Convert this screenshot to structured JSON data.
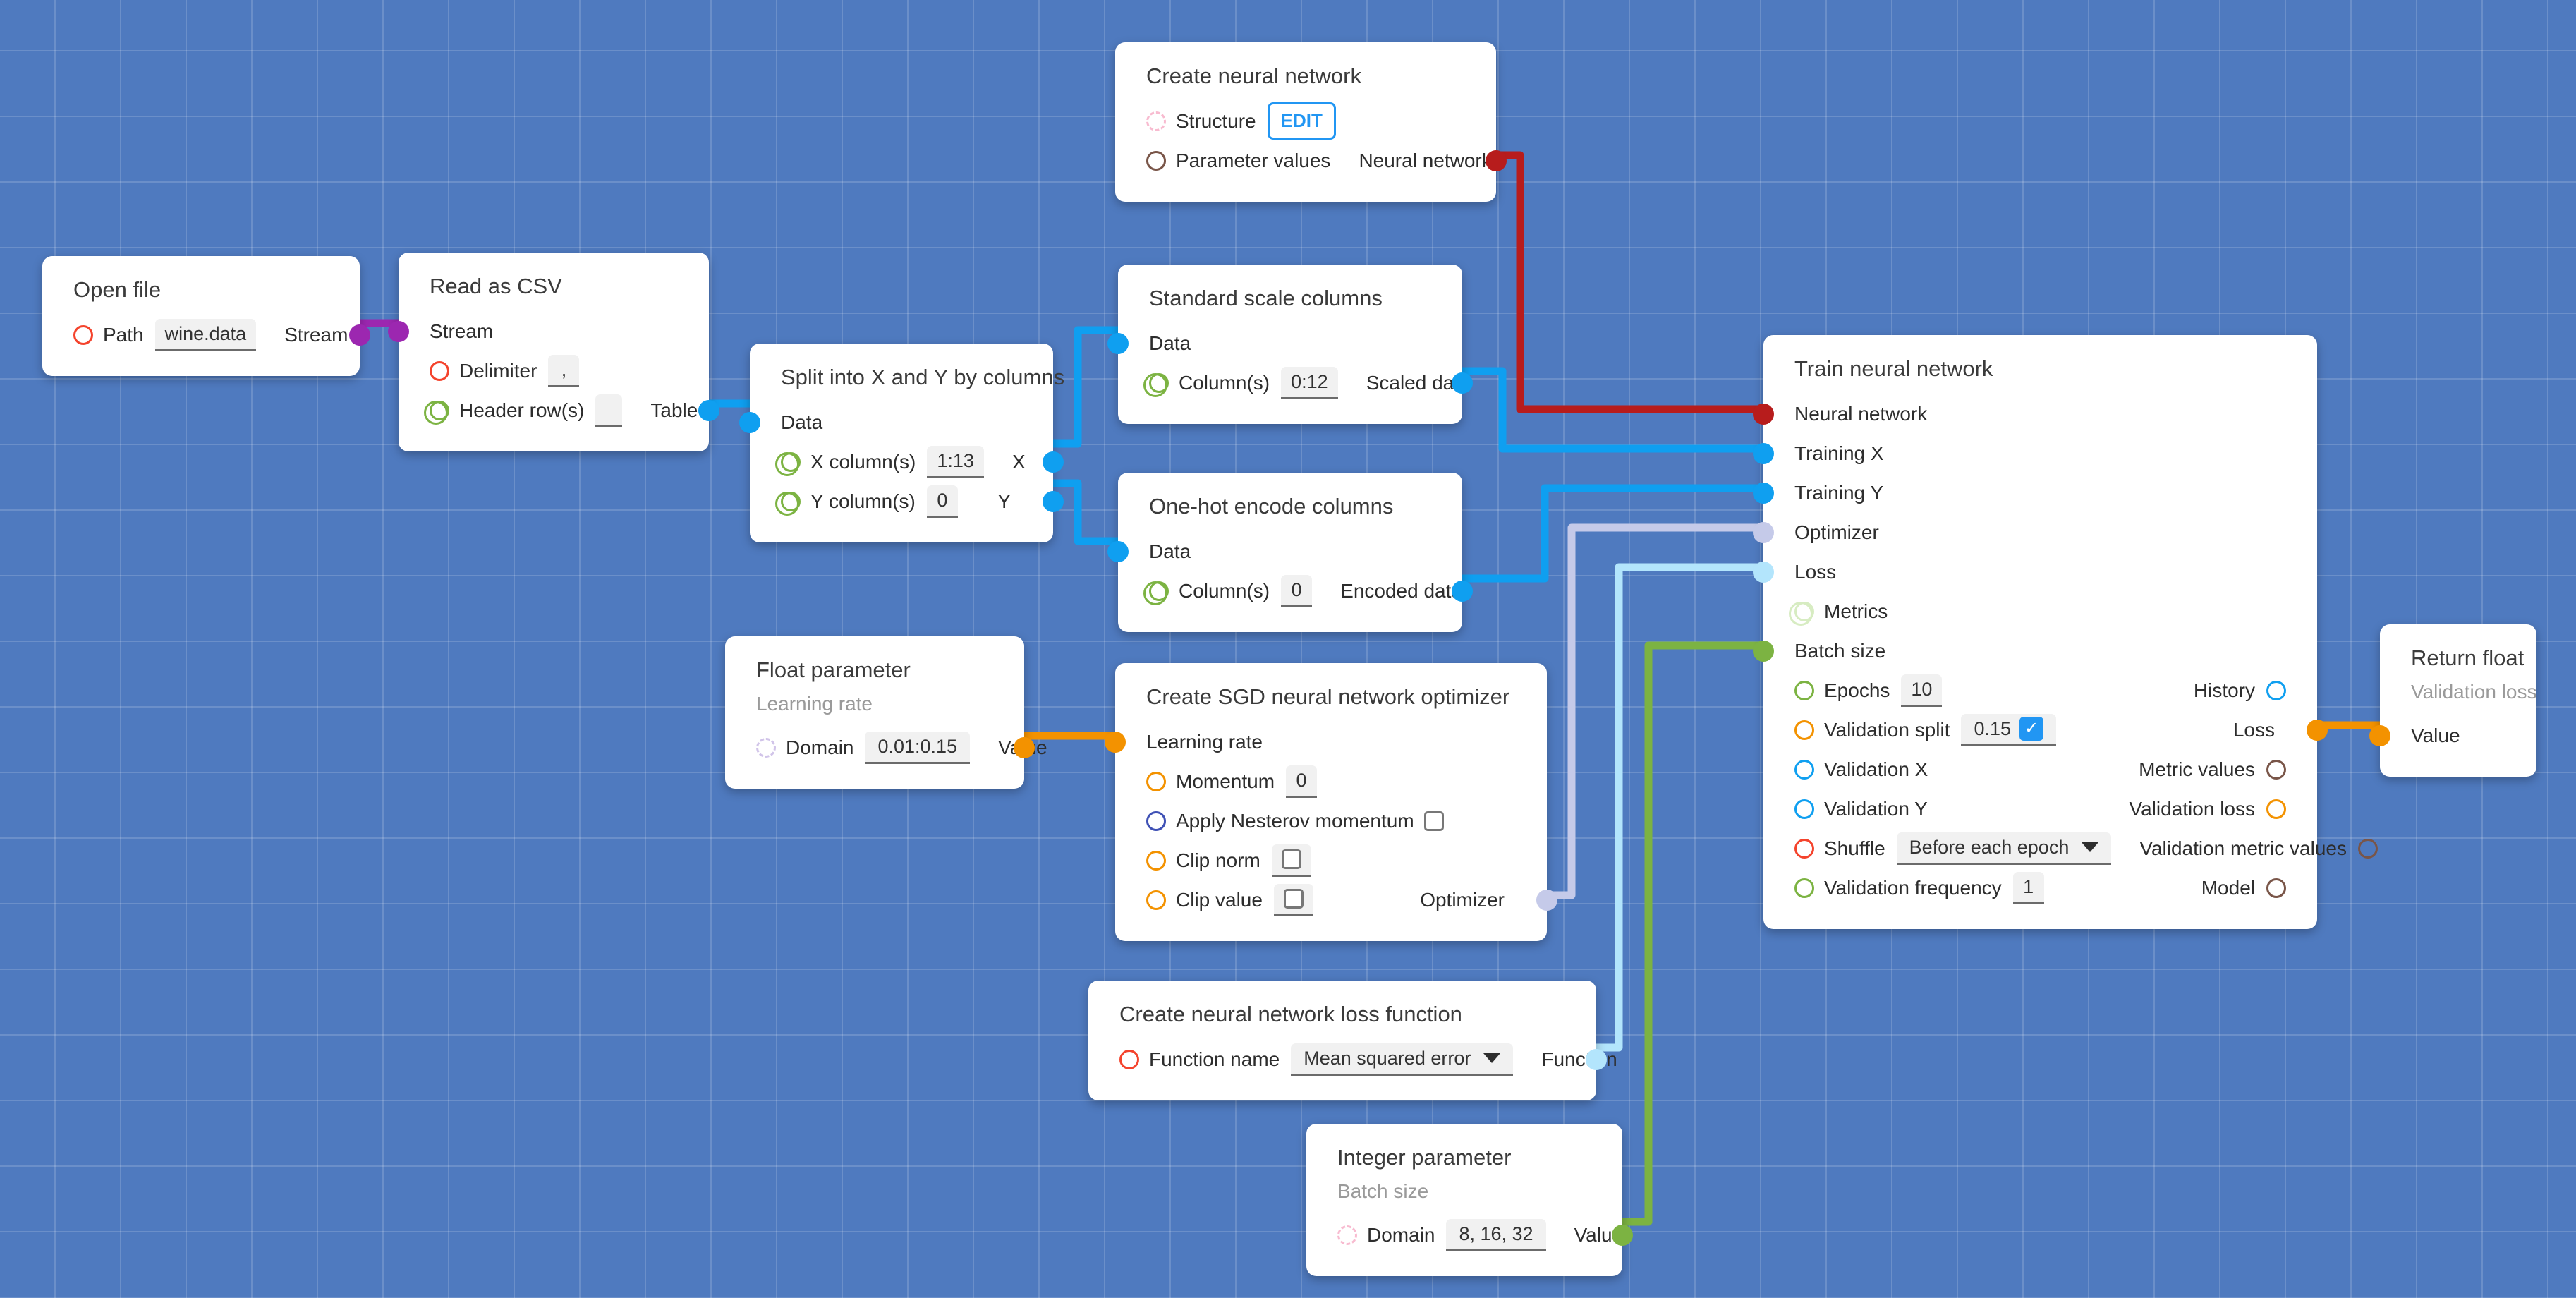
{
  "canvas": {
    "background_color": "#4f7abf",
    "grid_line_color": "rgba(255,255,255,0.16)"
  },
  "palette": {
    "purple": "#9c27b0",
    "blue": "#0f9ff0",
    "dark_red": "#b71c1c",
    "orange": "#f39200",
    "green": "#7cb342",
    "light_blue": "#b3e5fc",
    "lavender": "#c5cae9",
    "red_ring": "#f4432c",
    "brown_ring": "#795548",
    "pink_dashed": "#f8bbd0",
    "lavender_dashed": "#d1c4e9",
    "accent_blue": "#2196f3"
  },
  "nodes": {
    "create_nn": {
      "title": "Create neural network",
      "rows": [
        {
          "label": "Structure",
          "button": "EDIT"
        },
        {
          "label": "Parameter values",
          "out_label": "Neural network"
        }
      ]
    },
    "open_file": {
      "title": "Open file",
      "rows": [
        {
          "label": "Path",
          "value": "wine.data",
          "out_label": "Stream"
        }
      ]
    },
    "read_csv": {
      "title": "Read as CSV",
      "rows": [
        {
          "label": "Stream"
        },
        {
          "label": "Delimiter",
          "value": ","
        },
        {
          "label": "Header row(s)",
          "value": "",
          "out_label": "Table"
        }
      ]
    },
    "split_xy": {
      "title": "Split into X and Y by columns",
      "rows": [
        {
          "label": "Data"
        },
        {
          "label": "X column(s)",
          "value": "1:13",
          "out_label": "X"
        },
        {
          "label": "Y column(s)",
          "value": "0",
          "out_label": "Y"
        }
      ]
    },
    "std_scale": {
      "title": "Standard scale columns",
      "rows": [
        {
          "label": "Data"
        },
        {
          "label": "Column(s)",
          "value": "0:12",
          "out_label": "Scaled data"
        }
      ]
    },
    "onehot": {
      "title": "One-hot encode columns",
      "rows": [
        {
          "label": "Data"
        },
        {
          "label": "Column(s)",
          "value": "0",
          "out_label": "Encoded data"
        }
      ]
    },
    "float_param": {
      "title": "Float parameter",
      "subtitle": "Learning rate",
      "rows": [
        {
          "label": "Domain",
          "value": "0.01:0.15",
          "out_label": "Value"
        }
      ]
    },
    "sgd": {
      "title": "Create SGD neural network optimizer",
      "rows": [
        {
          "label": "Learning rate"
        },
        {
          "label": "Momentum",
          "value": "0"
        },
        {
          "label": "Apply Nesterov momentum",
          "checkbox": false
        },
        {
          "label": "Clip norm",
          "checkbox": false
        },
        {
          "label": "Clip value",
          "checkbox": false,
          "out_label": "Optimizer"
        }
      ]
    },
    "loss_fn": {
      "title": "Create neural network loss function",
      "rows": [
        {
          "label": "Function name",
          "value": "Mean squared error",
          "out_label": "Function"
        }
      ]
    },
    "int_param": {
      "title": "Integer parameter",
      "subtitle": "Batch size",
      "rows": [
        {
          "label": "Domain",
          "value": "8, 16, 32",
          "out_label": "Value"
        }
      ]
    },
    "train_nn": {
      "title": "Train neural network",
      "rows": [
        {
          "label": "Neural network",
          "out_label": ""
        },
        {
          "label": "Training X",
          "out_label": ""
        },
        {
          "label": "Training Y",
          "out_label": ""
        },
        {
          "label": "Optimizer",
          "out_label": ""
        },
        {
          "label": "Loss",
          "out_label": ""
        },
        {
          "label": "Metrics",
          "out_label": ""
        },
        {
          "label": "Batch size",
          "out_label": ""
        },
        {
          "label": "Epochs",
          "value": "10",
          "out_label": "History"
        },
        {
          "label": "Validation split",
          "value": "0.15",
          "checked": true,
          "out_label": "Loss"
        },
        {
          "label": "Validation X",
          "out_label": "Metric values"
        },
        {
          "label": "Validation Y",
          "out_label": "Validation loss"
        },
        {
          "label": "Shuffle",
          "value": "Before each epoch",
          "out_label": "Validation metric values"
        },
        {
          "label": "Validation frequency",
          "value": "1",
          "out_label": "Model"
        }
      ]
    },
    "return_float": {
      "title": "Return float",
      "subtitle": "Validation loss",
      "rows": [
        {
          "label": "Value"
        }
      ]
    }
  }
}
